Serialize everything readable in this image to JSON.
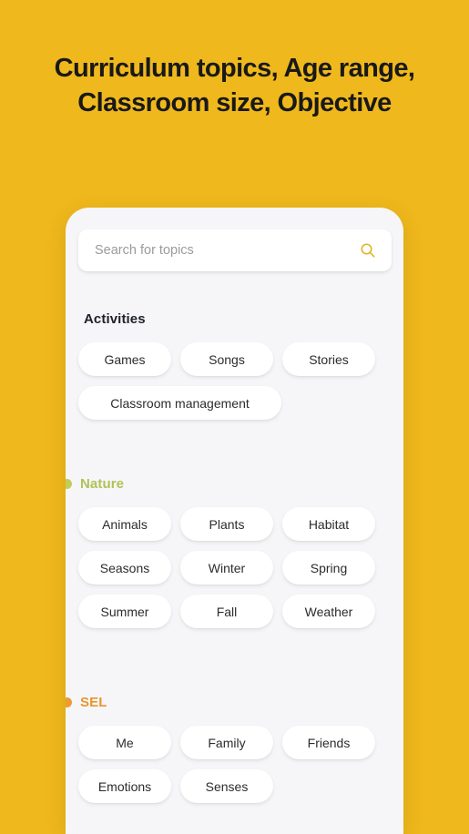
{
  "headline": {
    "line1": "Curriculum topics, Age range,",
    "line2": "Classroom size, Objective"
  },
  "colors": {
    "background": "#EFB81C",
    "panel": "#F6F6F8",
    "chip": "#FFFFFF",
    "search_icon": "#E2B32A",
    "activities_title": "#1E2128",
    "nature_title": "#AFC356",
    "sel_title": "#E8962E"
  },
  "search": {
    "placeholder": "Search for topics",
    "value": "",
    "icon": "search-icon"
  },
  "sections": [
    {
      "id": "activities",
      "title": "Activities",
      "color": "#1E2128",
      "has_dot": false,
      "dot_color": "",
      "chips": [
        {
          "label": "Games",
          "wide": false
        },
        {
          "label": "Songs",
          "wide": false
        },
        {
          "label": "Stories",
          "wide": false
        },
        {
          "label": "Classroom management",
          "wide": true
        }
      ]
    },
    {
      "id": "nature",
      "title": "Nature",
      "color": "#AFC356",
      "has_dot": true,
      "dot_color": "#C3CC58",
      "chips": [
        {
          "label": "Animals",
          "wide": false
        },
        {
          "label": "Plants",
          "wide": false
        },
        {
          "label": "Habitat",
          "wide": false
        },
        {
          "label": "Seasons",
          "wide": false
        },
        {
          "label": "Winter",
          "wide": false
        },
        {
          "label": "Spring",
          "wide": false
        },
        {
          "label": "Summer",
          "wide": false
        },
        {
          "label": "Fall",
          "wide": false
        },
        {
          "label": "Weather",
          "wide": false
        }
      ]
    },
    {
      "id": "sel",
      "title": "SEL",
      "color": "#E8962E",
      "has_dot": true,
      "dot_color": "#ED9B33",
      "chips": [
        {
          "label": "Me",
          "wide": false
        },
        {
          "label": "Family",
          "wide": false
        },
        {
          "label": "Friends",
          "wide": false
        },
        {
          "label": "Emotions",
          "wide": false
        },
        {
          "label": "Senses",
          "wide": false
        }
      ]
    }
  ]
}
